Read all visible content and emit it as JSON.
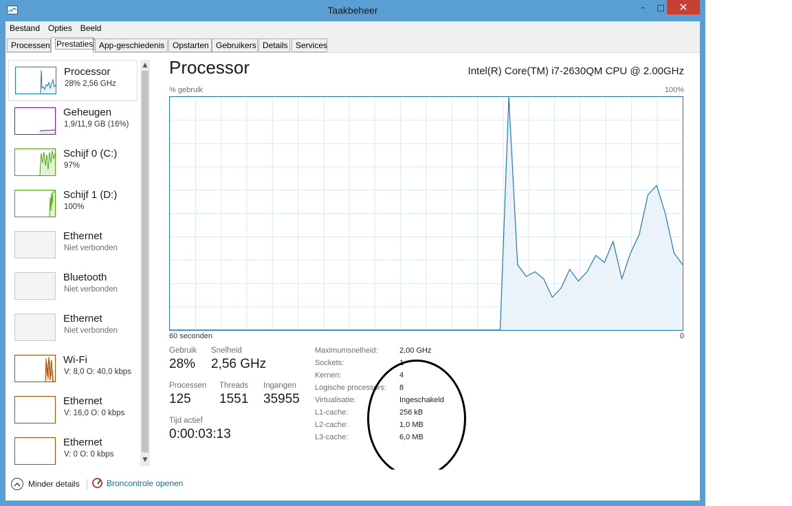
{
  "window": {
    "title": "Taakbeheer",
    "controls": {
      "minimize": "–",
      "maximize": "□",
      "close": "✕"
    }
  },
  "menu": [
    "Bestand",
    "Opties",
    "Beeld"
  ],
  "tabs": [
    {
      "label": "Processen",
      "active": false
    },
    {
      "label": "Prestaties",
      "active": true
    },
    {
      "label": "App-geschiedenis",
      "active": false
    },
    {
      "label": "Opstarten",
      "active": false
    },
    {
      "label": "Gebruikers",
      "active": false
    },
    {
      "label": "Details",
      "active": false
    },
    {
      "label": "Services",
      "active": false
    }
  ],
  "sidebar": {
    "items": [
      {
        "title": "Processor",
        "subtitle": "28% 2,56 GHz",
        "color": "#1e78b4",
        "active": true
      },
      {
        "title": "Geheugen",
        "subtitle": "1,9/11,9 GB (16%)",
        "color": "#8b12ae"
      },
      {
        "title": "Schijf 0 (C:)",
        "subtitle": "97%",
        "color": "#4da60c"
      },
      {
        "title": "Schijf 1 (D:)",
        "subtitle": "100%",
        "color": "#4da60c"
      },
      {
        "title": "Ethernet",
        "subtitle": "Niet verbonden",
        "color": "#999999",
        "disabled": true
      },
      {
        "title": "Bluetooth",
        "subtitle": "Niet verbonden",
        "color": "#999999",
        "disabled": true
      },
      {
        "title": "Ethernet",
        "subtitle": "Niet verbonden",
        "color": "#999999",
        "disabled": true
      },
      {
        "title": "Wi-Fi",
        "subtitle": "V: 8,0  O: 40,0 kbps",
        "color": "#a74f01"
      },
      {
        "title": "Ethernet",
        "subtitle": "V: 16,0  O: 0 kbps",
        "color": "#a74f01"
      },
      {
        "title": "Ethernet",
        "subtitle": "V: 0  O: 0 kbps",
        "color": "#a74f01"
      }
    ]
  },
  "detail": {
    "heading": "Processor",
    "cpu_name": "Intel(R) Core(TM) i7-2630QM CPU @ 2.00GHz",
    "graph": {
      "y_label": "% gebruik",
      "y_max_label": "100%",
      "x_left_label": "60 seconden",
      "x_right_label": "0",
      "line_color": "#1e78b4",
      "fill_color": "#eaf3fa",
      "series_percent": [
        0,
        0,
        0,
        0,
        0,
        0,
        0,
        0,
        0,
        0,
        0,
        0,
        0,
        0,
        0,
        0,
        0,
        0,
        0,
        0,
        0,
        0,
        0,
        0,
        0,
        0,
        0,
        0,
        0,
        0,
        0,
        0,
        0,
        0,
        0,
        0,
        0,
        0,
        0,
        100,
        28,
        23,
        25,
        22,
        14,
        18,
        26,
        21,
        25,
        32,
        29,
        38,
        22,
        33,
        41,
        58,
        62,
        50,
        33,
        28
      ]
    },
    "stats": {
      "usage": {
        "label": "Gebruik",
        "value": "28%"
      },
      "speed": {
        "label": "Snelheid",
        "value": "2,56 GHz"
      },
      "processes": {
        "label": "Processen",
        "value": "125"
      },
      "threads": {
        "label": "Threads",
        "value": "1551"
      },
      "handles": {
        "label": "Ingangen",
        "value": "35955"
      },
      "uptime": {
        "label": "Tijd actief",
        "value": "0:00:03:13"
      }
    },
    "specs": [
      {
        "label": "Maximumsnelheid:",
        "value": "2,00 GHz"
      },
      {
        "label": "Sockets:",
        "value": "1"
      },
      {
        "label": "Kernen:",
        "value": "4"
      },
      {
        "label": "Logische processors:",
        "value": "8"
      },
      {
        "label": "Virtualisatie:",
        "value": "Ingeschakeld"
      },
      {
        "label": "L1-cache:",
        "value": "256 kB"
      },
      {
        "label": "L2-cache:",
        "value": "1,0 MB"
      },
      {
        "label": "L3-cache:",
        "value": "6,0 MB"
      }
    ]
  },
  "footer": {
    "fewer_details": "Minder details",
    "resource_monitor": "Broncontrole openen"
  }
}
